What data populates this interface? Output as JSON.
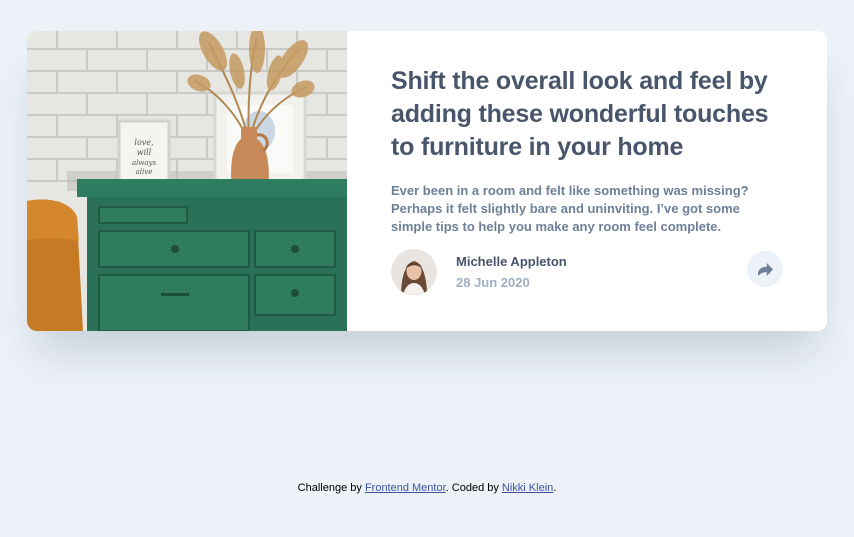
{
  "card": {
    "title": "Shift the overall look and feel by adding these wonderful touches to furniture in your home",
    "description": "Ever been in a room and felt like something was missing? Perhaps it felt slightly bare and uninviting. I’ve got some simple tips to help you make any room feel complete.",
    "image": {
      "frame_text": "love, will, always, alive"
    },
    "author": {
      "name": "Michelle Appleton",
      "date": "28 Jun 2020"
    },
    "share_icon": "share-arrow-icon"
  },
  "attribution": {
    "prefix": "Challenge by",
    "link1": "Frontend Mentor",
    "middle": ". Coded by",
    "link2": "Nikki Klein",
    "suffix": "."
  },
  "colors": {
    "page_bg": "#ecf2f8",
    "title": "#48556a",
    "body_text": "#6e8098",
    "muted": "#9eafc2",
    "link": "#3e52a3",
    "dresser": "#2f7a5e"
  }
}
